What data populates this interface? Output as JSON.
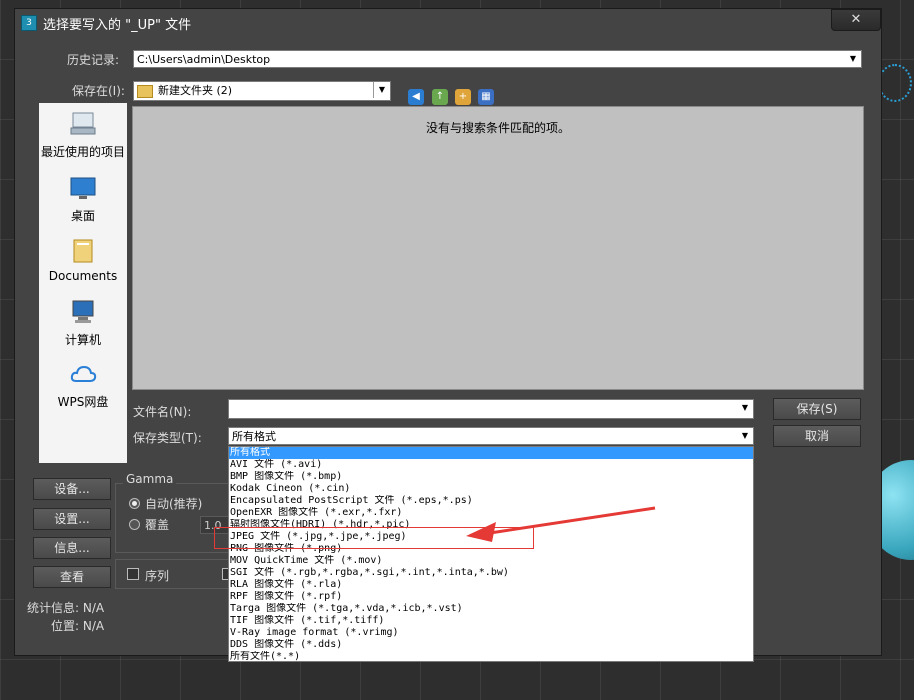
{
  "window": {
    "title": "选择要写入的 \"_UP\" 文件",
    "close_label": "✕"
  },
  "history": {
    "label": "历史记录:",
    "value": "C:\\Users\\admin\\Desktop"
  },
  "save_in": {
    "label": "保存在(I):",
    "value": "新建文件夹 (2)"
  },
  "places": [
    {
      "label": "最近使用的项目",
      "icon": "recent-icon"
    },
    {
      "label": "桌面",
      "icon": "desktop-icon"
    },
    {
      "label": "Documents",
      "icon": "documents-folder-icon"
    },
    {
      "label": "计算机",
      "icon": "computer-icon"
    },
    {
      "label": "WPS网盘",
      "icon": "cloud-icon"
    }
  ],
  "filelist": {
    "empty_message": "没有与搜索条件匹配的项。"
  },
  "filename": {
    "label": "文件名(N):",
    "value": ""
  },
  "filetype": {
    "label": "保存类型(T):",
    "value": "所有格式"
  },
  "buttons": {
    "save": "保存(S)",
    "cancel": "取消",
    "setup": "设备...",
    "settings": "设置...",
    "info": "信息...",
    "view": "查看"
  },
  "gamma": {
    "title": "Gamma",
    "auto_label": "自动(推荐)",
    "override_label": "覆盖",
    "override_value": "1.0"
  },
  "sequence_label": "序列",
  "stats": {
    "stats_label": "统计信息: N/A",
    "location_label": "位置: N/A"
  },
  "filetype_options": [
    "所有格式",
    "AVI 文件 (*.avi)",
    "BMP 图像文件 (*.bmp)",
    "Kodak Cineon (*.cin)",
    "Encapsulated PostScript 文件 (*.eps,*.ps)",
    "OpenEXR 图像文件 (*.exr,*.fxr)",
    "辐射图像文件(HDRI) (*.hdr,*.pic)",
    "JPEG 文件 (*.jpg,*.jpe,*.jpeg)",
    "PNG 图像文件 (*.png)",
    "MOV QuickTime 文件 (*.mov)",
    "SGI 文件 (*.rgb,*.rgba,*.sgi,*.int,*.inta,*.bw)",
    "RLA 图像文件 (*.rla)",
    "RPF 图像文件 (*.rpf)",
    "Targa 图像文件 (*.tga,*.vda,*.icb,*.vst)",
    "TIF 图像文件 (*.tif,*.tiff)",
    "V-Ray image format (*.vrimg)",
    "DDS 图像文件 (*.dds)",
    "所有文件(*.*)"
  ],
  "colors": {
    "dialog_bg": "#444444",
    "selection": "#3399ff",
    "annotation": "#e53935"
  }
}
